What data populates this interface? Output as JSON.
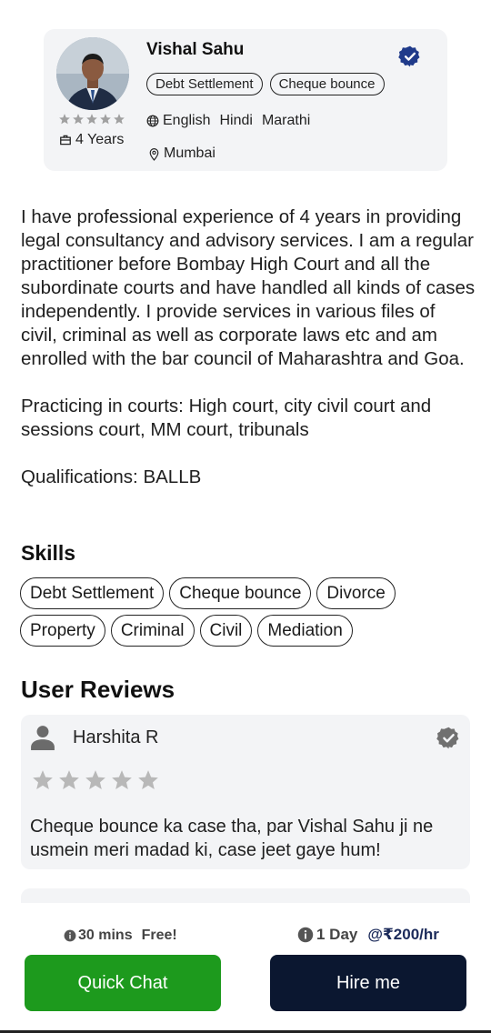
{
  "profile": {
    "name": "Vishal Sahu",
    "rating_stars": 5,
    "experience": "4 Years",
    "tags": [
      "Debt Settlement",
      "Cheque bounce"
    ],
    "languages": [
      "English",
      "Hindi",
      "Marathi"
    ],
    "location": "Mumbai"
  },
  "about": {
    "paragraphs": [
      "I have professional experience of 4 years in providing legal consultancy and advisory services. I am a regular practitioner before Bombay High Court and all the subordinate courts and have handled all kinds of cases independently. I provide services in various files of civil, criminal as well as corporate laws etc and am enrolled with the bar council of Maharashtra and Goa.",
      "Practicing in courts: High court, city civil court and sessions court, MM court, tribunals",
      "Qualifications: BALLB"
    ]
  },
  "skills": {
    "title": "Skills",
    "items": [
      "Debt Settlement",
      "Cheque bounce",
      "Divorce",
      "Property",
      "Criminal",
      "Civil",
      "Mediation"
    ]
  },
  "reviews": {
    "title": "User Reviews",
    "items": [
      {
        "reviewer": "Harshita R",
        "stars": 5,
        "text": "Cheque bounce ka case tha, par Vishal Sahu ji ne usmein meri madad ki, case jeet gaye hum!"
      }
    ]
  },
  "bottom": {
    "chat_duration": "30 mins",
    "chat_price": "Free!",
    "hire_duration": "1 Day",
    "hire_price": "@₹200/hr",
    "quick_chat_label": "Quick Chat",
    "hire_label": "Hire me"
  },
  "colors": {
    "verified_blue": "#1f3a8a",
    "chat_green": "#1d9a1d",
    "hire_navy": "#0b1730",
    "star_grey": "#b8b8b8",
    "card_bg": "#f3f4f6"
  },
  "icons": [
    "verified-badge-icon",
    "star-icon",
    "briefcase-icon",
    "globe-icon",
    "location-pin-icon",
    "user-icon",
    "info-icon"
  ]
}
